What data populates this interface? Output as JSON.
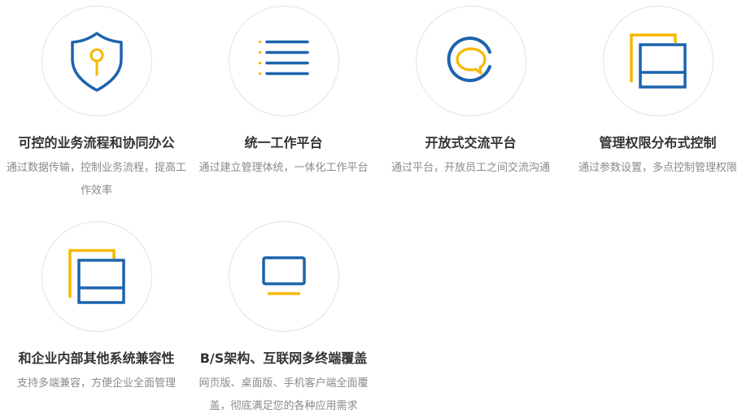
{
  "features": [
    {
      "icon": "shield-key-icon",
      "title": "可控的业务流程和协同办公",
      "desc": "通过数据传输，控制业务流程，提高工作效率"
    },
    {
      "icon": "list-icon",
      "title": "统一工作平台",
      "desc": "通过建立管理体统，一体化工作平台"
    },
    {
      "icon": "chat-bubble-icon",
      "title": "开放式交流平台",
      "desc": "通过平台，开放员工之间交流沟通"
    },
    {
      "icon": "stacked-windows-icon",
      "title": "管理权限分布式控制",
      "desc": "通过参数设置，多点控制管理权限"
    },
    {
      "icon": "stacked-windows-icon",
      "title": "和企业内部其他系统兼容性",
      "desc": "支持多端兼容，方便企业全面管理"
    },
    {
      "icon": "monitor-icon",
      "title": "B/S架构、互联网多终端覆盖",
      "desc": "网页版、桌面版、手机客户端全面覆盖，彻底满足您的各种应用需求"
    }
  ],
  "colors": {
    "blue": "#1c64ad",
    "yellow": "#f5b800",
    "title": "#333333",
    "desc": "#8a8a8a"
  }
}
